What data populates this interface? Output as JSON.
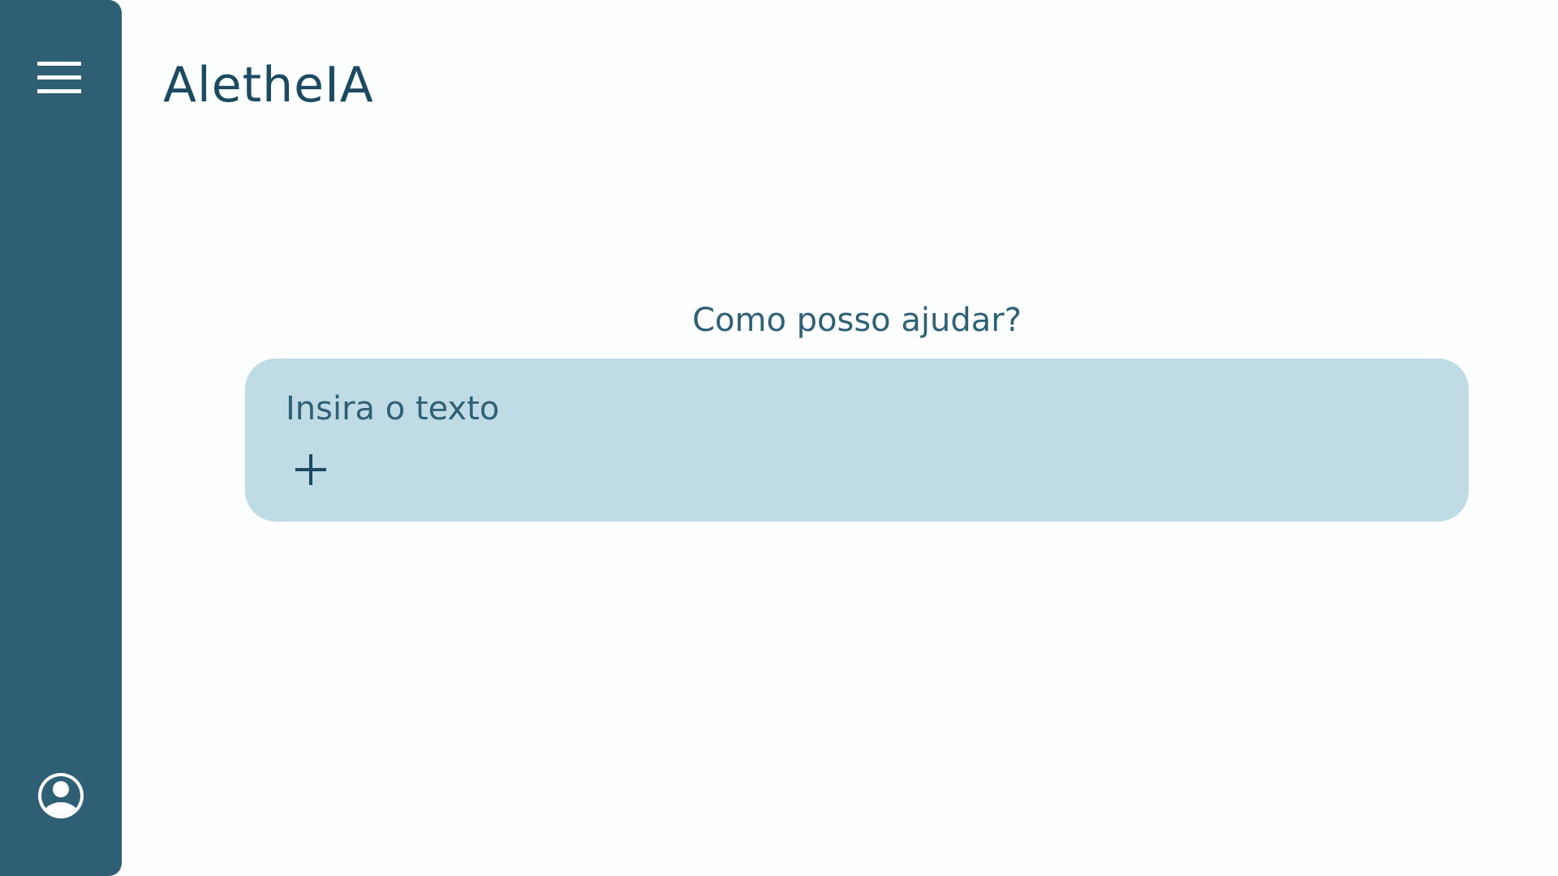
{
  "app": {
    "title": "AletheIA"
  },
  "sidebar": {
    "menu_icon": "hamburger-menu-icon",
    "profile_icon": "user-account-icon"
  },
  "main": {
    "heading": "Como posso ajudar?",
    "composer": {
      "placeholder": "Insira o texto",
      "value": "",
      "add_icon": "plus-icon"
    }
  },
  "colors": {
    "sidebar": "#2f5f74",
    "title_text": "#1b4a61",
    "accent_text": "#2f6075",
    "composer_bg": "#bfdbe5",
    "page_bg": "#fdfeff"
  }
}
